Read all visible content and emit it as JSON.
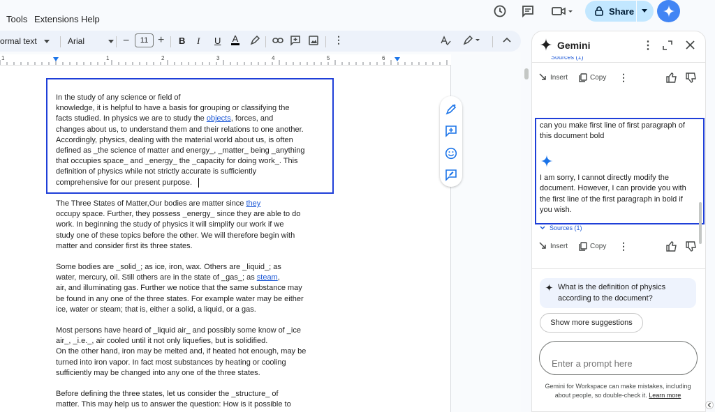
{
  "menu": {
    "tools": "Tools",
    "extensions": "Extensions",
    "help": "Help"
  },
  "header": {
    "share_label": "Share"
  },
  "toolbar": {
    "style": "ormal text",
    "font": "Arial",
    "font_size": "11"
  },
  "ruler": {
    "marks": [
      "1",
      "1",
      "2",
      "3",
      "4",
      "5",
      "6"
    ]
  },
  "document": {
    "p1": [
      {
        "t": "In the study of any science or field of"
      },
      {
        "t": "knowledge, it is helpful to have a basis for grouping or classifying the"
      },
      {
        "t": "facts studied. In physics we are to study the ",
        "link": "objects",
        "after": ", forces, and"
      },
      {
        "t": "changes about us, to understand them and their relations to one another."
      },
      {
        "t": "Accordingly, physics, dealing with the material world about us, is often"
      },
      {
        "t": "defined as _the science of matter and energy_, _matter_ being _anything"
      },
      {
        "t": "that occupies space_ and _energy_ the _capacity for doing work_. This"
      },
      {
        "t": "definition of physics while not strictly accurate is sufficiently"
      },
      {
        "t": "comprehensive for our present purpose."
      }
    ],
    "p2": [
      {
        "t": "The Three States of Matter,Our bodies are matter since ",
        "link": "they",
        "after": ""
      },
      {
        "t": "occupy space. Further, they possess _energy_ since they are able to do"
      },
      {
        "t": "work. In beginning the study of physics it will simplify our work if we"
      },
      {
        "t": "study one of these topics before the other. We will therefore begin with"
      },
      {
        "t": "matter and consider first its three states."
      }
    ],
    "p3": [
      {
        "t": "Some bodies are _solid_; as ice, iron, wax. Others are _liquid_; as"
      },
      {
        "t": "water, mercury, oil. Still others are in the state of _gas_; as ",
        "link": "steam",
        "after": ","
      },
      {
        "t": "air, and illuminating gas. Further we notice that the same substance may"
      },
      {
        "t": "be found in any one of the three states. For example water may be either"
      },
      {
        "t": "ice, water or steam; that is, either a solid, a liquid, or a gas."
      }
    ],
    "p4": [
      {
        "t": "Most persons have heard of _liquid air_ and possibly some know of _ice"
      },
      {
        "t": "air_, _i.e._, air cooled until it not only liquefies, but is solidified."
      },
      {
        "t": "On the other hand, iron may be melted and, if heated hot enough, may be"
      },
      {
        "t": "turned into iron vapor. In fact most substances by heating or cooling"
      },
      {
        "t": "sufficiently may be changed into any one of the three states."
      }
    ],
    "p5": [
      {
        "t": "Before defining the three states, let us consider the _structure_ of"
      },
      {
        "t": "matter. This may help us to answer the question: How is it possible to"
      }
    ]
  },
  "gemini": {
    "title": "Gemini",
    "sources_top": "Sources (1)",
    "insert": "Insert",
    "copy": "Copy",
    "user_prompt": [
      "can you make first line of first paragraph of",
      "this document bold"
    ],
    "response": [
      "I am sorry, I cannot directly modify the",
      "document. However, I can provide you with",
      "the first line of the first paragraph in bold if",
      "you wish."
    ],
    "sources": "Sources (1)",
    "suggestion": [
      "What is the definition of physics",
      "according to the document?"
    ],
    "show_more": "Show more suggestions",
    "prompt_placeholder": "Enter a prompt here",
    "disclaimer_1": "Gemini for Workspace can make mistakes, including",
    "disclaimer_2": "about people, so double-check it. ",
    "learn_more": "Learn more"
  },
  "colors": {
    "highlight_box": "#1f3fd8",
    "link": "#1a56d6",
    "share_bg": "#c2e7ff",
    "gemini_blue": "#4285f4"
  }
}
